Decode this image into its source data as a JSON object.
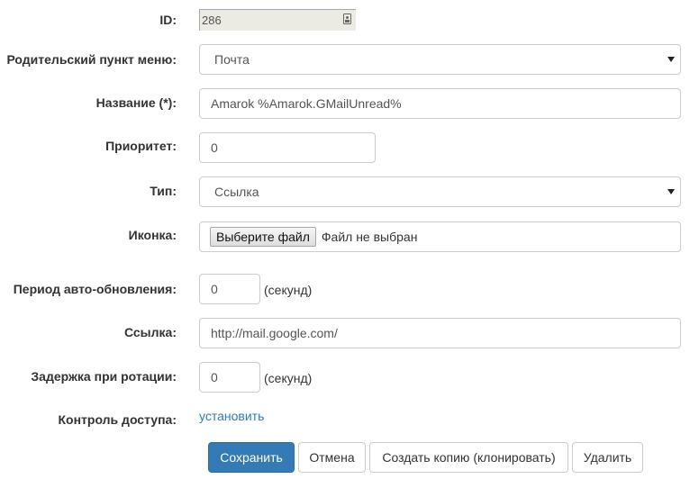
{
  "form": {
    "id": {
      "label": "ID:",
      "value": "286"
    },
    "parent": {
      "label": "Родительский пункт меню:",
      "value": "Почта"
    },
    "name": {
      "label": "Название (*):",
      "value": "Amarok %Amarok.GMailUnread%"
    },
    "priority": {
      "label": "Приоритет:",
      "value": "0"
    },
    "type": {
      "label": "Тип:",
      "value": "Ссылка"
    },
    "icon": {
      "label": "Иконка:",
      "button": "Выберите файл",
      "status": "Файл не выбран"
    },
    "refresh": {
      "label": "Период авто-обновления:",
      "value": "0",
      "unit": "(секунд)"
    },
    "url": {
      "label": "Ссылка:",
      "value": "http://mail.google.com/"
    },
    "rotation": {
      "label": "Задержка при ротации:",
      "value": "0",
      "unit": "(секунд)"
    },
    "access": {
      "label": "Контроль доступа:",
      "link": "установить"
    }
  },
  "buttons": {
    "save": "Сохранить",
    "cancel": "Отмена",
    "clone": "Создать копию (клонировать)",
    "delete": "Удалить"
  },
  "colors": {
    "primary": "#337ab7",
    "link": "#337ab7",
    "readonly_bg": "#ebebe4"
  },
  "icons": {
    "id_field": "contact-card-icon",
    "select": "chevron-down-icon"
  }
}
